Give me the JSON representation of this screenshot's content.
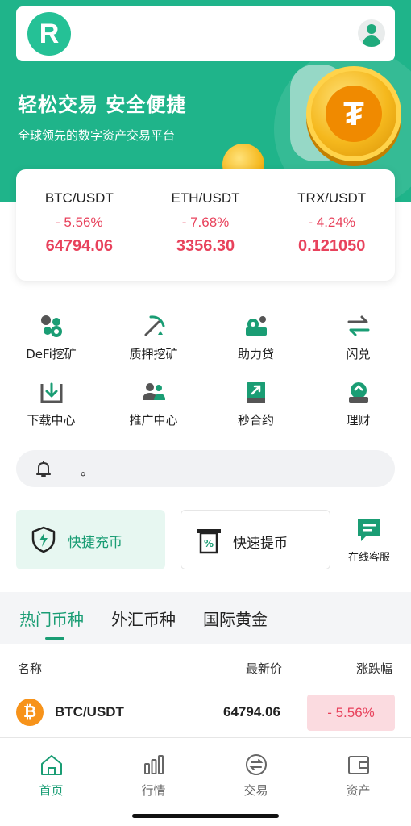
{
  "header": {
    "logo_letter": "R",
    "avatar_icon": "user-icon"
  },
  "hero": {
    "title": "轻松交易 安全便捷",
    "subtitle": "全球领先的数字资产交易平台",
    "background": "#1fb48a"
  },
  "tickers": [
    {
      "pair": "BTC/USDT",
      "change": "- 5.56%",
      "price": "64794.06"
    },
    {
      "pair": "ETH/USDT",
      "change": "- 7.68%",
      "price": "3356.30"
    },
    {
      "pair": "TRX/USDT",
      "change": "- 4.24%",
      "price": "0.121050"
    }
  ],
  "features": [
    {
      "label": "DeFi挖矿",
      "icon": "defi-mining-icon"
    },
    {
      "label": "质押挖矿",
      "icon": "pickaxe-icon"
    },
    {
      "label": "助力贷",
      "icon": "loan-icon"
    },
    {
      "label": "闪兑",
      "icon": "swap-arrows-icon"
    },
    {
      "label": "下载中心",
      "icon": "download-icon"
    },
    {
      "label": "推广中心",
      "icon": "users-icon"
    },
    {
      "label": "秒合约",
      "icon": "contract-icon"
    },
    {
      "label": "理财",
      "icon": "finance-icon"
    }
  ],
  "notice": {
    "icon": "bell-icon",
    "text": "。"
  },
  "quick_actions": {
    "deposit_label": "快捷充币",
    "withdraw_label": "快速提币",
    "service_label": "在线客服"
  },
  "market_tabs": [
    {
      "label": "热门币种",
      "active": true
    },
    {
      "label": "外汇币种",
      "active": false
    },
    {
      "label": "国际黄金",
      "active": false
    }
  ],
  "list_header": {
    "name": "名称",
    "latest_price": "最新价",
    "change": "涨跌幅"
  },
  "market_rows": [
    {
      "symbol": "BTC/USDT",
      "price": "64794.06",
      "change": "- 5.56%",
      "coin_icon": "bitcoin-icon"
    }
  ],
  "bottom_nav": [
    {
      "label": "首页",
      "icon": "home-icon",
      "active": true
    },
    {
      "label": "行情",
      "icon": "bar-chart-icon",
      "active": false
    },
    {
      "label": "交易",
      "icon": "exchange-icon",
      "active": false
    },
    {
      "label": "资产",
      "icon": "wallet-icon",
      "active": false
    }
  ],
  "colors": {
    "accent": "#1a9d74",
    "down": "#e8425c",
    "down_bg": "#fbdbe0"
  }
}
